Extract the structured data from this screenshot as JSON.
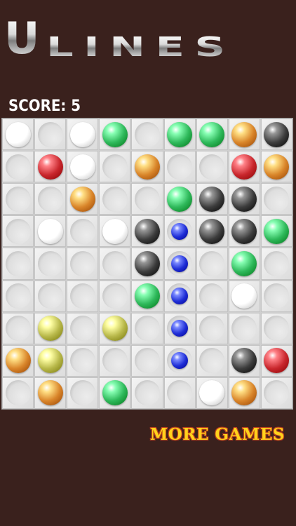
{
  "logo": {
    "first_letter": "U",
    "rest": "LINES"
  },
  "score": {
    "label": "SCORE:",
    "value": "5"
  },
  "board": {
    "size": 9,
    "colors": {
      "white": "#ffffff",
      "green": "#2eb85a",
      "orange": "#d9852a",
      "black": "#3c3c3c",
      "red": "#c9272d",
      "blue": "#1f2ed6",
      "yellow": "#b8b84a"
    },
    "cells": [
      [
        "white",
        "",
        "white",
        "green",
        "",
        "green",
        "green",
        "orange",
        "black"
      ],
      [
        "",
        "red",
        "white",
        "",
        "orange",
        "",
        "",
        "red",
        "orange"
      ],
      [
        "",
        "",
        "orange",
        "",
        "",
        "green",
        "black",
        "black",
        ""
      ],
      [
        "",
        "white",
        "",
        "white",
        "black",
        "blue",
        "black",
        "black",
        "green"
      ],
      [
        "",
        "",
        "",
        "",
        "black",
        "blue",
        "",
        "green",
        ""
      ],
      [
        "",
        "",
        "",
        "",
        "green",
        "blue",
        "",
        "white",
        ""
      ],
      [
        "",
        "yellow",
        "",
        "yellow",
        "",
        "blue",
        "",
        "",
        ""
      ],
      [
        "orange",
        "yellow",
        "",
        "",
        "",
        "blue",
        "",
        "black",
        "red"
      ],
      [
        "",
        "orange",
        "",
        "green",
        "",
        "",
        "white",
        "orange",
        ""
      ]
    ],
    "small_cells": [
      "blue"
    ]
  },
  "more_games": {
    "label": "MORE GAMES"
  }
}
